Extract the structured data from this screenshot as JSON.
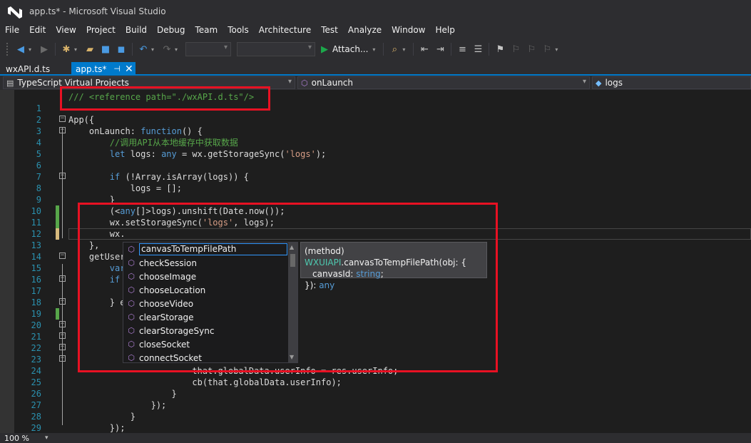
{
  "window": {
    "title": "app.ts* - Microsoft Visual Studio"
  },
  "menu": [
    "File",
    "Edit",
    "View",
    "Project",
    "Build",
    "Debug",
    "Team",
    "Tools",
    "Architecture",
    "Test",
    "Analyze",
    "Window",
    "Help"
  ],
  "toolbar": {
    "attach_label": "Attach..."
  },
  "tabs": [
    {
      "label": "wxAPI.d.ts",
      "active": false
    },
    {
      "label": "app.ts*",
      "active": true
    }
  ],
  "navigation": {
    "project": "TypeScript Virtual Projects",
    "scope": "onLaunch",
    "member": "logs"
  },
  "editor": {
    "lines": [
      {
        "n": "1",
        "text": "/// <reference path=\"./wxAPI.d.ts\"/>"
      },
      {
        "n": "2",
        "text": ""
      },
      {
        "n": "3",
        "text": "App({"
      },
      {
        "n": "4",
        "text": "    onLaunch: function() {"
      },
      {
        "n": "5",
        "text": "        //调用API从本地缓存中获取数据"
      },
      {
        "n": "6",
        "text": "        let logs: any = wx.getStorageSync('logs');"
      },
      {
        "n": "7",
        "text": ""
      },
      {
        "n": "8",
        "text": "        if (!Array.isArray(logs)) {"
      },
      {
        "n": "9",
        "text": "            logs = [];"
      },
      {
        "n": "10",
        "text": "        }"
      },
      {
        "n": "11",
        "text": "        (<any[]>logs).unshift(Date.now());"
      },
      {
        "n": "12",
        "text": "        wx.setStorageSync('logs', logs);"
      },
      {
        "n": "13",
        "text": "        wx."
      },
      {
        "n": "14",
        "text": "    },"
      },
      {
        "n": "15",
        "text": "    getUser"
      },
      {
        "n": "16",
        "text": "        var"
      },
      {
        "n": "17",
        "text": "        if"
      },
      {
        "n": "18",
        "text": ""
      },
      {
        "n": "19",
        "text": "        } e"
      },
      {
        "n": "20",
        "text": ""
      },
      {
        "n": "21",
        "text": ""
      },
      {
        "n": "22",
        "text": ""
      },
      {
        "n": "23",
        "text": ""
      },
      {
        "n": "24",
        "text": ""
      },
      {
        "n": "25",
        "text": "                        that.globalData.userInfo = res.userInfo;"
      },
      {
        "n": "26",
        "text": "                        cb(that.globalData.userInfo);"
      },
      {
        "n": "27",
        "text": "                    }"
      },
      {
        "n": "28",
        "text": "                });"
      },
      {
        "n": "29",
        "text": "            }"
      },
      {
        "n": "30",
        "text": "        });"
      }
    ]
  },
  "completion": {
    "items": [
      "canvasToTempFilePath",
      "checkSession",
      "chooseImage",
      "chooseLocation",
      "chooseVideo",
      "clearStorage",
      "clearStorageSync",
      "closeSocket",
      "connectSocket"
    ],
    "selected_index": 0
  },
  "tooltip": {
    "line1_prefix": "(method) ",
    "line1_type": "WXUIAPI",
    "line1_rest": ".canvasToTempFilePath(obj: {",
    "line2_name": "canvasId: ",
    "line2_type": "string",
    "line2_end": ";",
    "line3_prefix": "}): ",
    "line3_type": "any"
  },
  "status": {
    "zoom": "100 %"
  },
  "colors": {
    "accent": "#007acc",
    "highlight_box": "#e81123",
    "background": "#1e1e1e"
  }
}
